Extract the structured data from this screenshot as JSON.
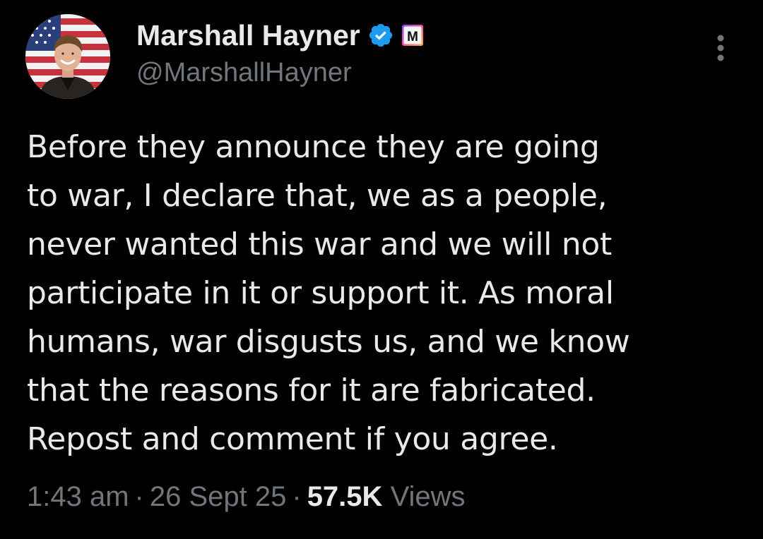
{
  "author": {
    "display_name": "Marshall Hayner",
    "handle": "@MarshallHayner",
    "verified": true,
    "affiliation_badge_letter": "M",
    "avatar_icon": "profile-photo-with-flag-background"
  },
  "more_menu_icon": "vertical-ellipsis-icon",
  "tweet": {
    "lines": [
      "Before they announce they are going",
      "to war, I declare that, we as a people,",
      "never wanted this war and we will not",
      "participate in it or support it. As moral",
      "humans, war disgusts us, and we know",
      "that the reasons for it are fabricated.",
      "Repost and comment if you agree."
    ]
  },
  "meta": {
    "time": "1:43 am",
    "separator": "·",
    "date": "26 Sept 25",
    "views_count": "57.5K",
    "views_label": "Views"
  },
  "colors": {
    "background": "#000000",
    "text_primary": "#e7e9ea",
    "text_secondary": "#71767b",
    "verified_blue": "#1d9bf0"
  }
}
